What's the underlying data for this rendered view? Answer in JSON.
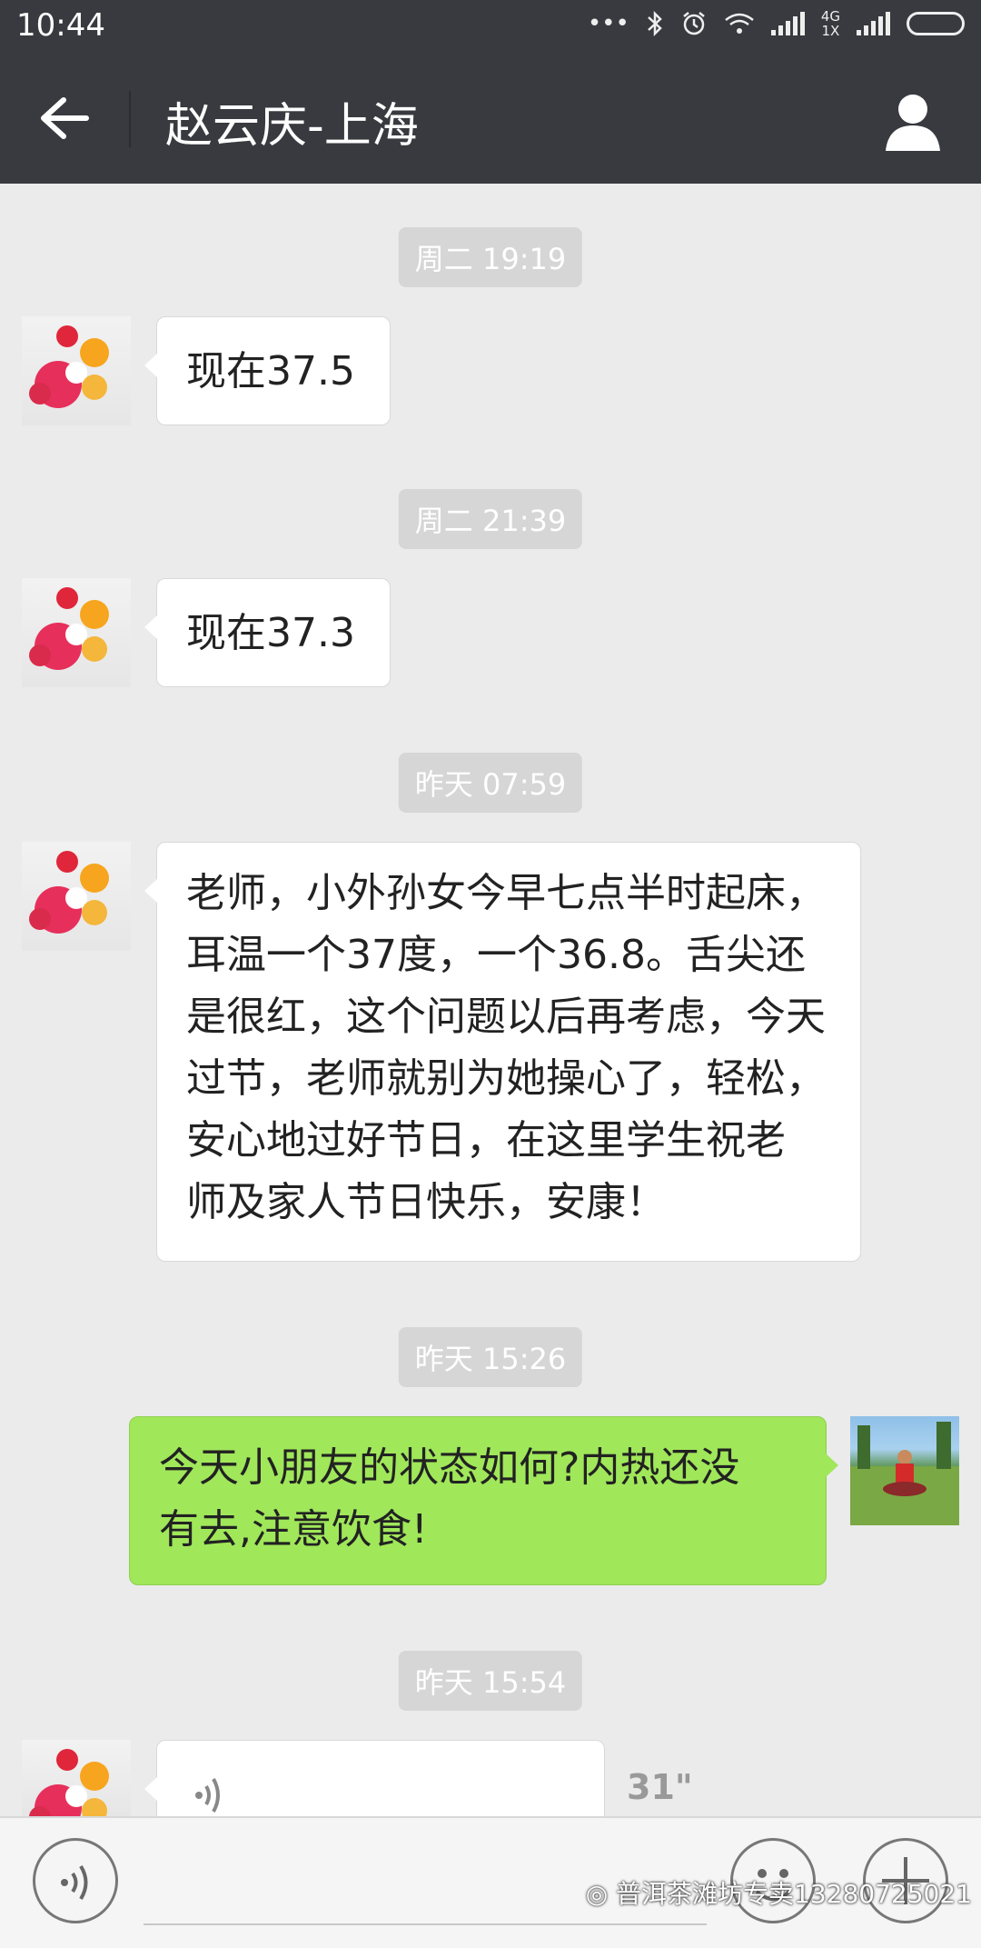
{
  "status_bar": {
    "time": "10:44",
    "dots": "•••",
    "network_top": "4G",
    "network_bottom": "1X"
  },
  "header": {
    "title": "赵云庆-上海"
  },
  "chat": {
    "timestamps": [
      "周二 19:19",
      "周二 21:39",
      "昨天 07:59",
      "昨天 15:26",
      "昨天 15:54"
    ],
    "messages": [
      {
        "side": "left",
        "text": "现在37.5"
      },
      {
        "side": "left",
        "text": "现在37.3"
      },
      {
        "side": "left",
        "lines": [
          "老师，小外孙女今早七点半时起床，",
          "耳温一个37度，一个36.8。舌尖还",
          "是很红，这个问题以后再考虑，今天",
          "过节，老师就别为她操心了，轻松，",
          "安心地过好节日，在这里学生祝老",
          "师及家人节日快乐，安康！"
        ]
      },
      {
        "side": "right",
        "lines": [
          "今天小朋友的状态如何?内热还没",
          "有去,注意饮食!"
        ]
      },
      {
        "side": "left",
        "type": "voice",
        "duration": "31\""
      }
    ]
  },
  "input_bar": {
    "watermark": "普洱茶滩坊专卖13280725021"
  }
}
